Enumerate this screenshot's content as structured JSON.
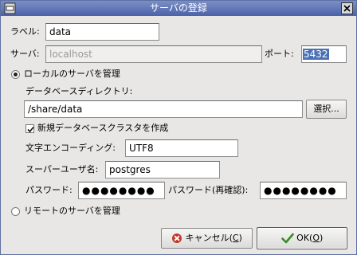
{
  "window": {
    "title": "サーバの登録"
  },
  "form": {
    "label_caption": "ラベル:",
    "label_value": "data",
    "server_caption": "サーバ:",
    "server_placeholder": "localhost",
    "port_caption": "ポート:",
    "port_value": "5432",
    "local_radio_label": "ローカルのサーバを管理",
    "local_selected": true,
    "dir_caption": "データベースディレクトリ:",
    "dir_value": "/share/data",
    "browse_label": "選択...",
    "create_cluster_label": "新規データベースクラスタを作成",
    "create_cluster_checked": true,
    "encoding_caption": "文字エンコーディング:",
    "encoding_value": "UTF8",
    "superuser_caption": "スーパーユーザ名:",
    "superuser_value": "postgres",
    "password_caption": "パスワード:",
    "password_value": "●●●●●●●●",
    "password_confirm_caption": "パスワード(再確認):",
    "password_confirm_value": "●●●●●●●●",
    "remote_radio_label": "リモートのサーバを管理",
    "remote_selected": false
  },
  "buttons": {
    "cancel_label": "キャンセル(",
    "cancel_mnemonic": "C",
    "ok_label": "OK(",
    "ok_mnemonic": "O",
    "close_paren": ")"
  },
  "icons": {
    "window_menu": "window-menu-icon",
    "close": "close-icon",
    "cancel": "cancel-x-icon",
    "ok": "ok-check-icon"
  },
  "colors": {
    "titlebar": "#4c62a8",
    "selection": "#4c72b5",
    "cancel_icon": "#c0392b",
    "ok_icon": "#3a8a2a"
  }
}
